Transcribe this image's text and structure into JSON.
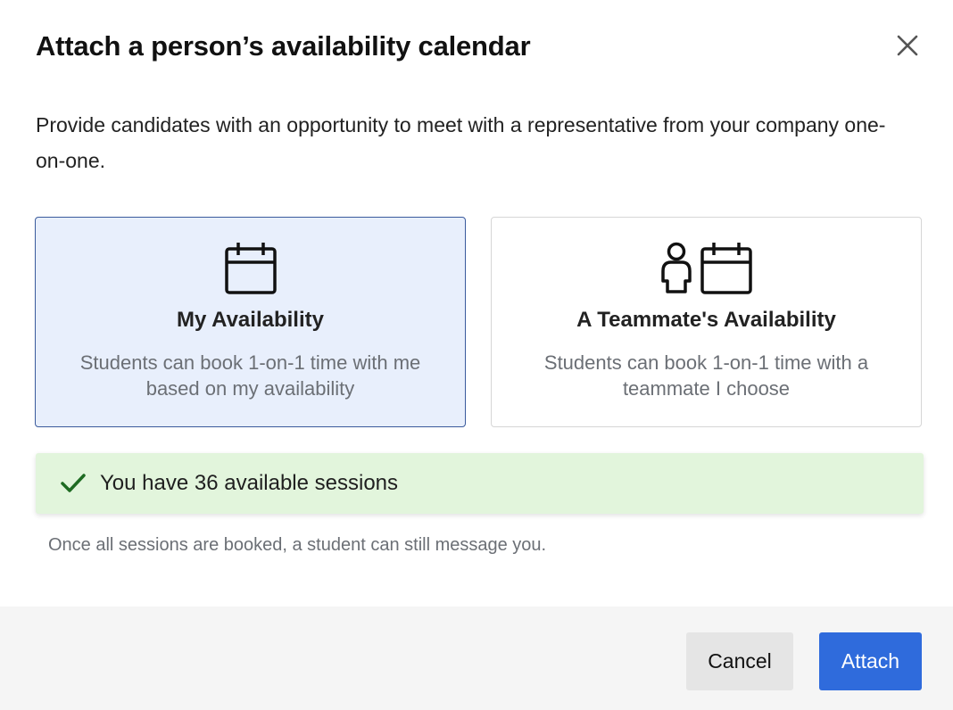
{
  "dialog": {
    "title": "Attach a person’s availability calendar",
    "description": "Provide candidates with an opportunity to meet with a representative from your company one-on-one."
  },
  "options": [
    {
      "title": "My Availability",
      "description": "Students can book 1-on-1 time with me based on my availability",
      "selected": true,
      "icons": [
        "calendar-icon"
      ]
    },
    {
      "title": "A Teammate's Availability",
      "description": "Students can book 1-on-1 time with a teammate I choose",
      "selected": false,
      "icons": [
        "person-icon",
        "calendar-icon"
      ]
    }
  ],
  "banner": {
    "icon": "checkmark-icon",
    "message": "You have 36 available sessions",
    "color": "#e2f5dc"
  },
  "note": "Once all sessions are booked, a student can still message you.",
  "footer": {
    "cancel_label": "Cancel",
    "attach_label": "Attach",
    "accent_color": "#2f6bdc"
  },
  "close_icon": "close-icon"
}
